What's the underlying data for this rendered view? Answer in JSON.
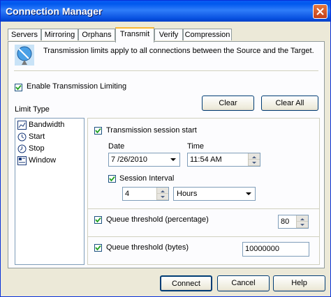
{
  "window": {
    "title": "Connection Manager"
  },
  "tabs": [
    {
      "label": "Servers"
    },
    {
      "label": "Mirroring"
    },
    {
      "label": "Orphans"
    },
    {
      "label": "Transmit"
    },
    {
      "label": "Verify"
    },
    {
      "label": "Compression"
    }
  ],
  "info": {
    "text": "Transmission limits apply to all connections between the Source and the Target.",
    "icon": "satellite-dish-icon"
  },
  "enable": {
    "label": "Enable Transmission Limiting",
    "checked": true
  },
  "buttons": {
    "clear": "Clear",
    "clear_all": "Clear All",
    "connect": "Connect",
    "cancel": "Cancel",
    "help": "Help"
  },
  "limit_type": {
    "label": "Limit Type",
    "items": [
      {
        "label": "Bandwidth",
        "icon": "bandwidth-chart-icon"
      },
      {
        "label": "Start",
        "icon": "clock-icon"
      },
      {
        "label": "Stop",
        "icon": "stop-clock-icon"
      },
      {
        "label": "Window",
        "icon": "window-schedule-icon"
      }
    ]
  },
  "session_start": {
    "label": "Transmission session start",
    "date_label": "Date",
    "date_value": "7 /26/2010",
    "time_label": "Time",
    "time_value": "11:54 AM",
    "interval_label": "Session Interval",
    "interval_value": "4",
    "interval_unit": "Hours"
  },
  "queue_pct": {
    "label": "Queue threshold (percentage)",
    "value": "80"
  },
  "queue_bytes": {
    "label": "Queue threshold (bytes)",
    "value": "10000000"
  }
}
